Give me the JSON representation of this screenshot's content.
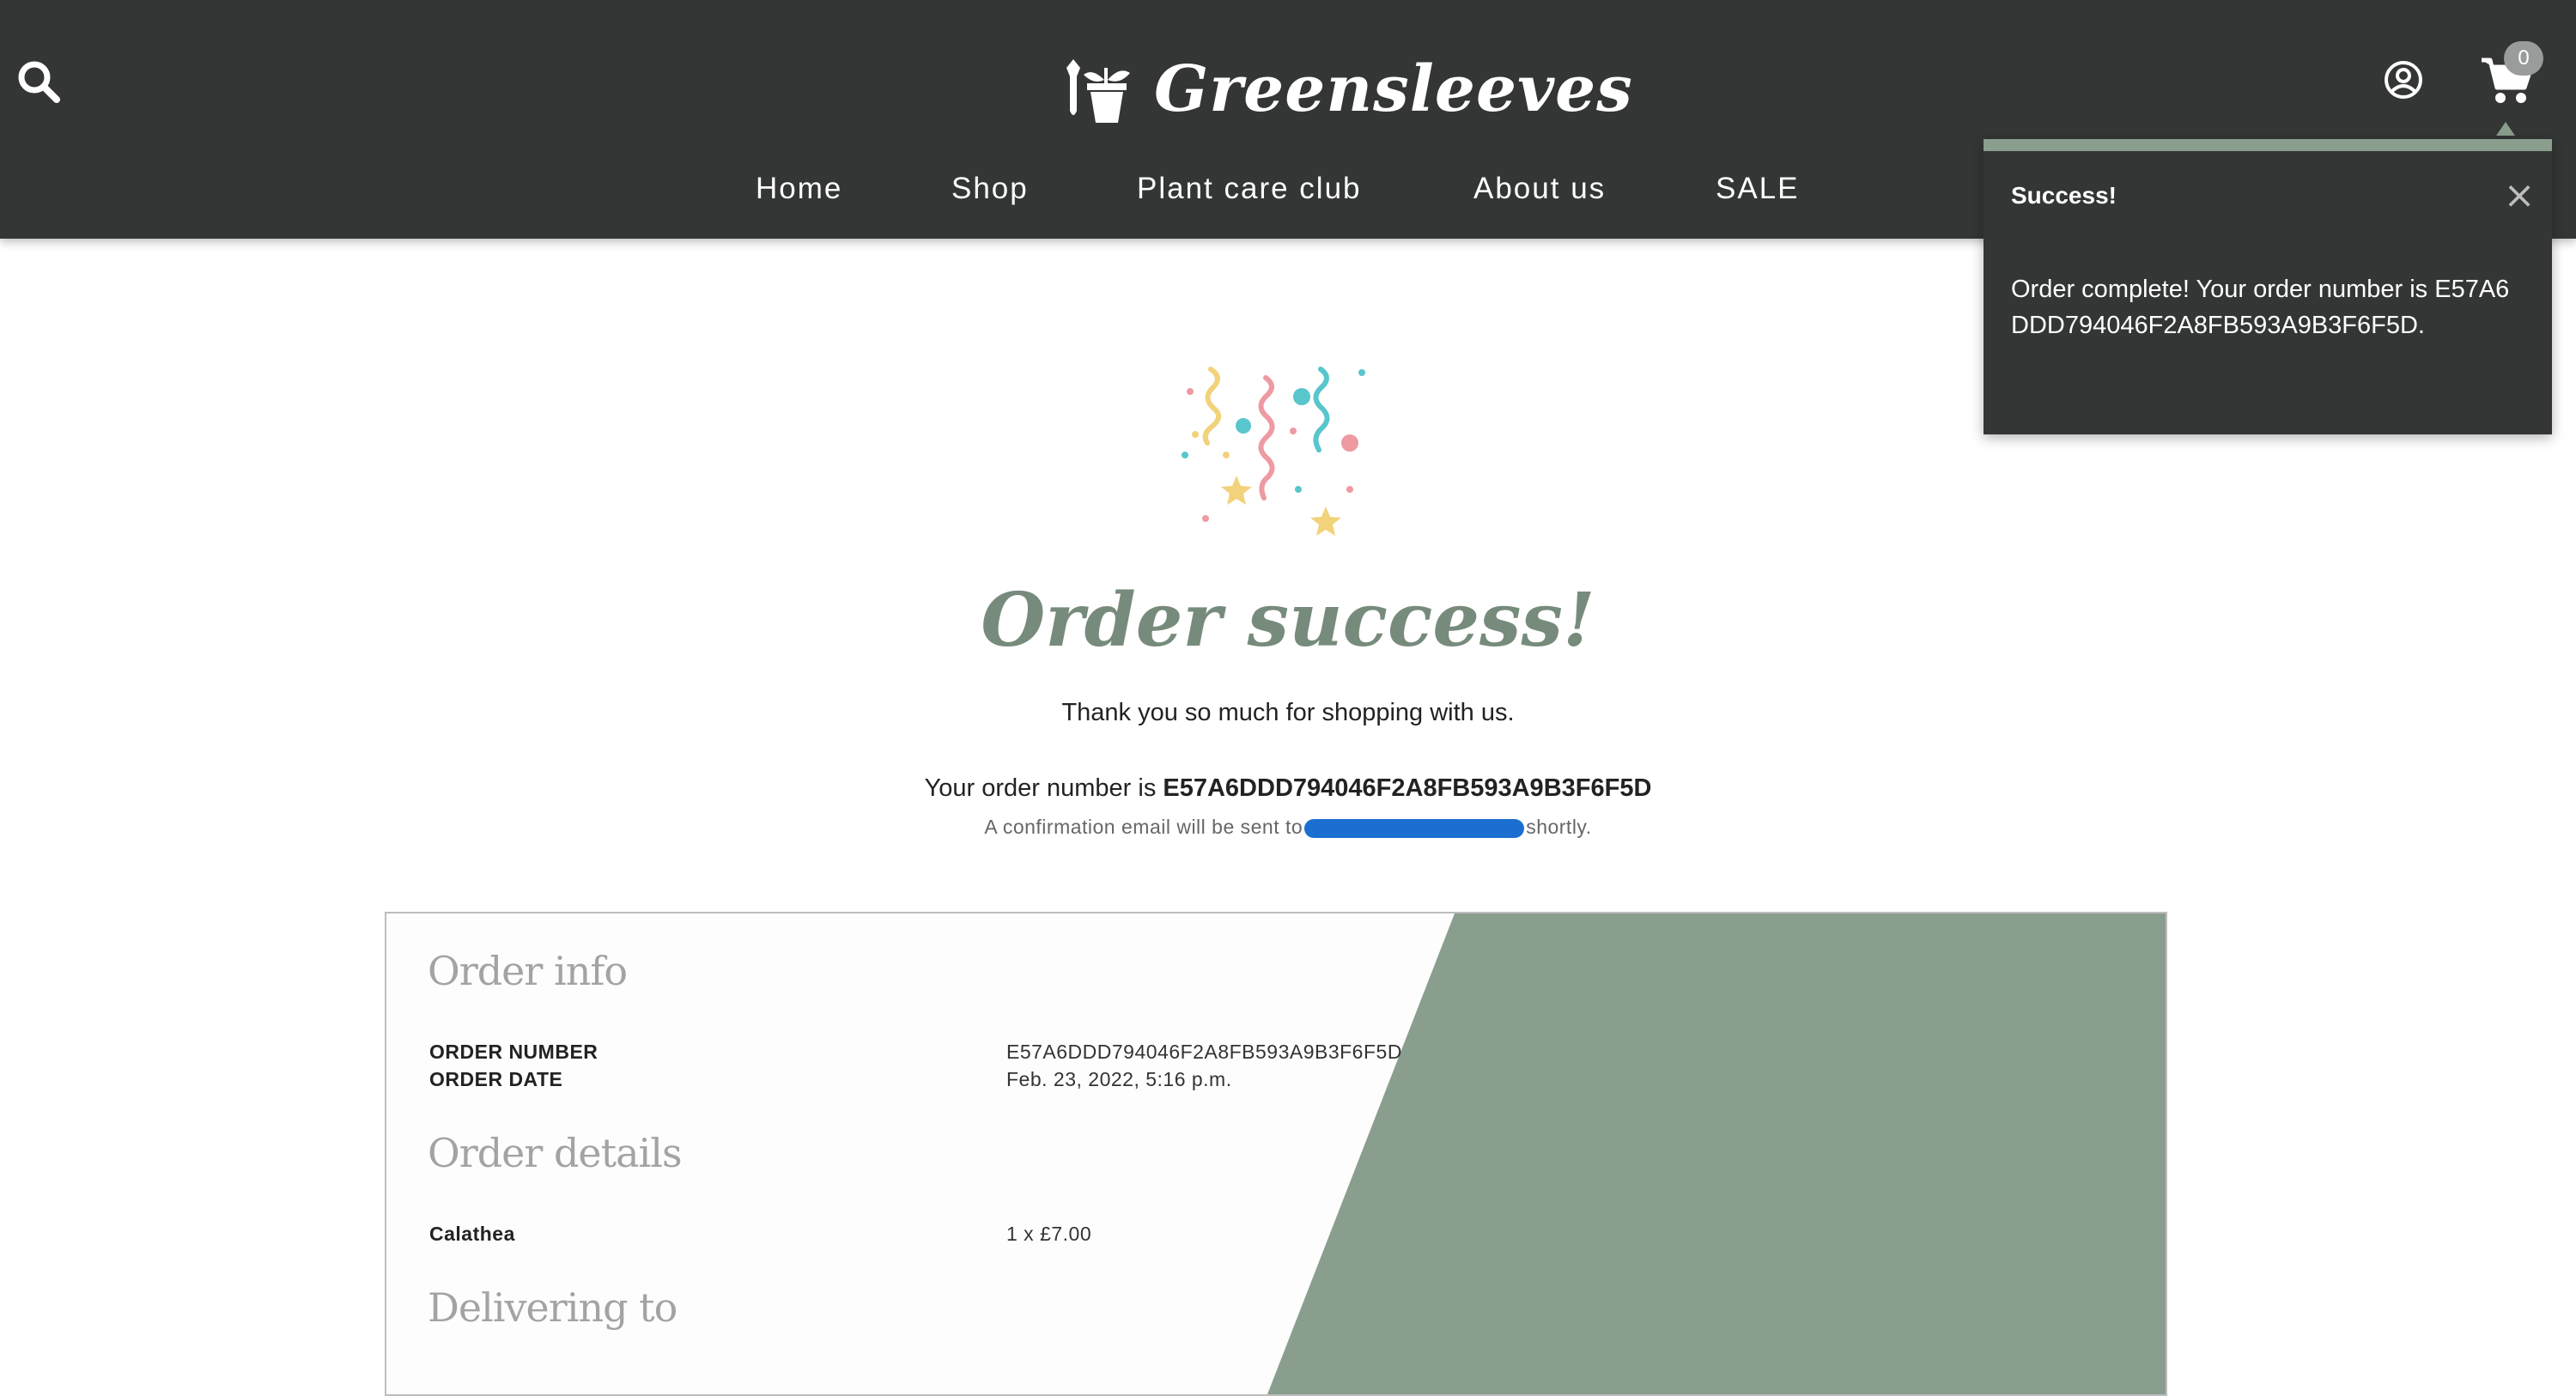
{
  "brand": {
    "name": "Greensleeves"
  },
  "nav": {
    "items": [
      "Home",
      "Shop",
      "Plant care club",
      "About us",
      "SALE"
    ]
  },
  "cart": {
    "count": "0"
  },
  "toast": {
    "title": "Success!",
    "message": "Order complete! Your order number is E57A6DDD794046F2A8FB593A9B3F6F5D."
  },
  "main": {
    "heading": "Order success!",
    "thanks": "Thank you so much for shopping with us.",
    "order_prefix": "Your order number is ",
    "order_number": "E57A6DDD794046F2A8FB593A9B3F6F5D",
    "confirm_prefix": "A confirmation email will be sent to",
    "confirm_suffix": "shortly."
  },
  "order_info": {
    "title": "Order info",
    "rows": [
      {
        "label": "ORDER NUMBER",
        "value": "E57A6DDD794046F2A8FB593A9B3F6F5D"
      },
      {
        "label": "ORDER DATE",
        "value": "Feb. 23, 2022, 5:16 p.m."
      }
    ]
  },
  "order_details": {
    "title": "Order details",
    "items": [
      {
        "name": "Calathea",
        "value": "1 x £7.00"
      }
    ]
  },
  "delivering": {
    "title": "Delivering to"
  },
  "colors": {
    "header_bg": "#343636",
    "accent_green": "#8a9e8e",
    "heading_green": "#778b7c",
    "redaction_blue": "#1a6fd0"
  }
}
